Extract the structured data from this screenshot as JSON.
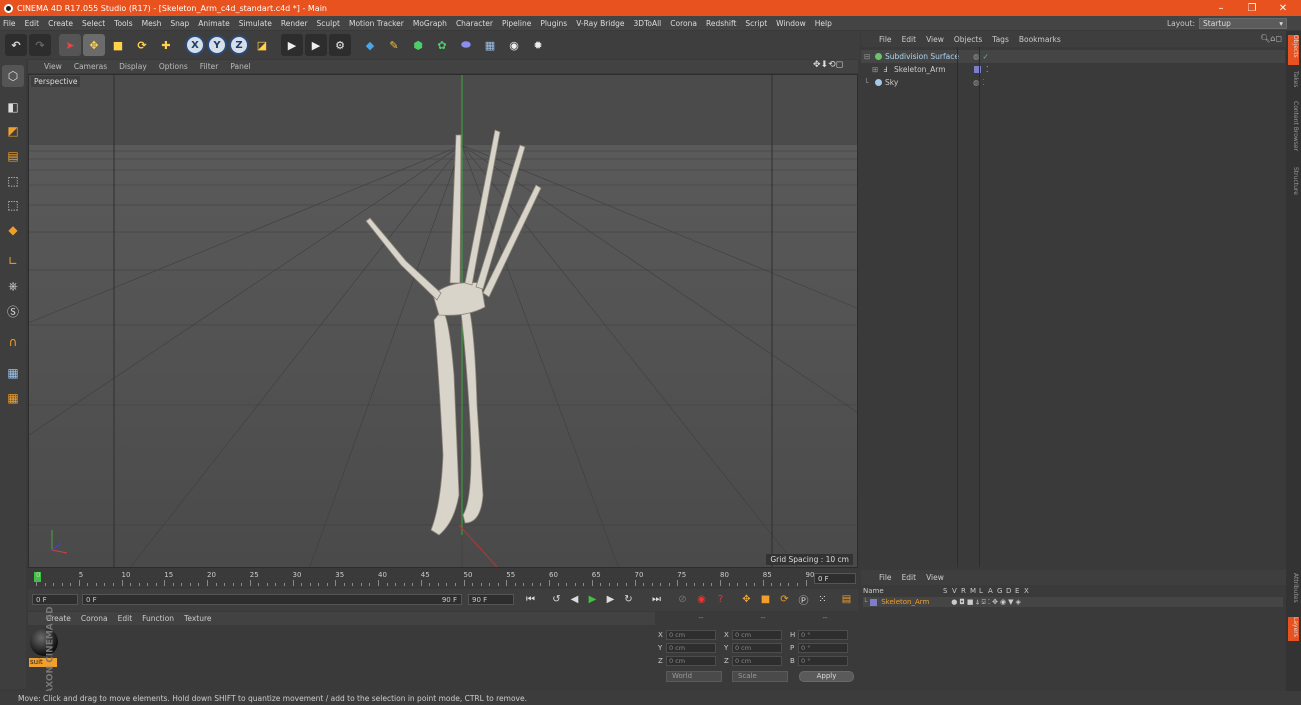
{
  "window": {
    "title": "CINEMA 4D R17.055 Studio (R17) - [Skeleton_Arm_c4d_standart.c4d *] - Main",
    "minimize": "–",
    "maximize": "❐",
    "close": "✕"
  },
  "menu": [
    "File",
    "Edit",
    "Create",
    "Select",
    "Tools",
    "Mesh",
    "Snap",
    "Animate",
    "Simulate",
    "Render",
    "Sculpt",
    "Motion Tracker",
    "MoGraph",
    "Character",
    "Pipeline",
    "Plugins",
    "V-Ray Bridge",
    "3DToAll",
    "Corona",
    "Redshift",
    "Script",
    "Window",
    "Help"
  ],
  "layout": {
    "label": "Layout:",
    "value": "Startup"
  },
  "toolbar": {
    "x": "X",
    "y": "Y",
    "z": "Z"
  },
  "viewport": {
    "menu": [
      "View",
      "Cameras",
      "Display",
      "Options",
      "Filter",
      "Panel"
    ],
    "label": "Perspective",
    "grid_spacing": "Grid Spacing : 10 cm"
  },
  "timeline": {
    "ticks": [
      "0",
      "5",
      "10",
      "15",
      "20",
      "25",
      "30",
      "35",
      "40",
      "45",
      "50",
      "55",
      "60",
      "65",
      "70",
      "75",
      "80",
      "85",
      "90"
    ],
    "current_frame": "0 F"
  },
  "playback": {
    "start": "0 F",
    "range_start": "0 F",
    "range_end": "90 F",
    "end": "90 F"
  },
  "materials": {
    "menu": [
      "Create",
      "Corona",
      "Edit",
      "Function",
      "Texture"
    ],
    "items": [
      {
        "name": "suit"
      }
    ],
    "brand": "MAXON CINEMA 4D"
  },
  "coords": {
    "headers": [
      "--",
      "--",
      "--"
    ],
    "rows": [
      {
        "a": "X",
        "av": "0 cm",
        "b": "X",
        "bv": "0 cm",
        "c": "H",
        "cv": "0 °"
      },
      {
        "a": "Y",
        "av": "0 cm",
        "b": "Y",
        "bv": "0 cm",
        "c": "P",
        "cv": "0 °"
      },
      {
        "a": "Z",
        "av": "0 cm",
        "b": "Z",
        "bv": "0 cm",
        "c": "B",
        "cv": "0 °"
      }
    ],
    "world": "World",
    "scale": "Scale",
    "apply": "Apply"
  },
  "objects": {
    "menu": [
      "File",
      "Edit",
      "View",
      "Objects",
      "Tags",
      "Bookmarks"
    ],
    "items": [
      {
        "name": "Subdivision Surface",
        "color": "#6cc36c"
      },
      {
        "name": "Skeleton_Arm",
        "color": "#cccccc"
      },
      {
        "name": "Sky",
        "color": "#a9c7e6"
      }
    ]
  },
  "layers": {
    "menu": [
      "File",
      "Edit",
      "View"
    ],
    "columns": [
      "Name",
      "S",
      "V",
      "R",
      "M",
      "L",
      "A",
      "G",
      "D",
      "E",
      "X"
    ],
    "items": [
      {
        "name": "Skeleton_Arm",
        "color": "#7e7ec8"
      }
    ]
  },
  "right_tabs": [
    "Objects",
    "Takes",
    "Content Browser",
    "Structure",
    "Attributes",
    "Layers"
  ],
  "status": "Move: Click and drag to move elements. Hold down SHIFT to quantize movement / add to the selection in point mode, CTRL to remove.",
  "colors": {
    "accent": "#e8521e",
    "selection": "#f0a02a"
  }
}
